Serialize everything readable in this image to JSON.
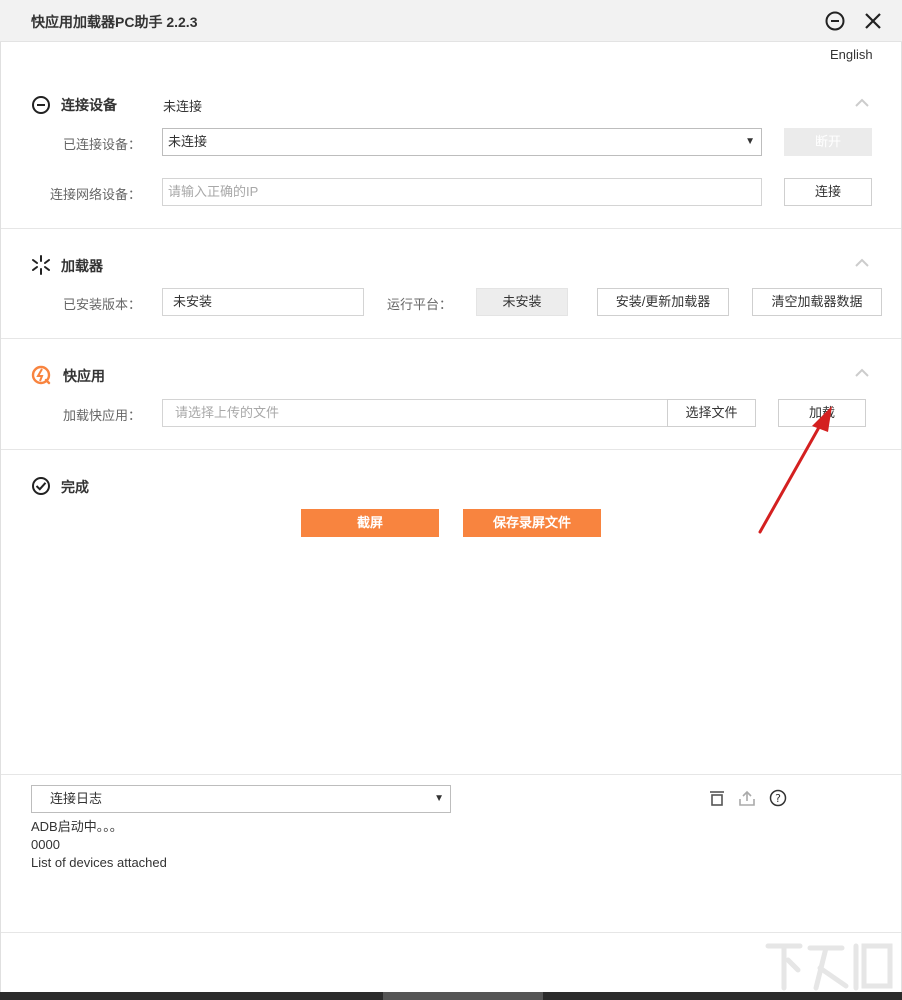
{
  "window": {
    "title": "快应用加载器PC助手 2.2.3",
    "language": "English"
  },
  "connect": {
    "title": "连接设备",
    "status": "未连接",
    "device_label": "已连接设备：",
    "device_value": "未连接",
    "disconnect_label": "断开",
    "network_label": "连接网络设备：",
    "ip_placeholder": "请输入正确的IP",
    "connect_label": "连接"
  },
  "loader": {
    "title": "加载器",
    "version_label": "已安装版本：",
    "version_value": "未安装",
    "platform_label": "运行平台：",
    "platform_value": "未安装",
    "install_label": "安装/更新加载器",
    "clear_label": "清空加载器数据"
  },
  "quickapp": {
    "title": "快应用",
    "load_label": "加载快应用：",
    "file_placeholder": "请选择上传的文件",
    "choose_label": "选择文件",
    "load_button": "加载"
  },
  "done": {
    "title": "完成",
    "screenshot_label": "截屏",
    "save_record_label": "保存录屏文件"
  },
  "log": {
    "selected": "连接日志",
    "lines": [
      "ADB启动中。。。",
      "0000",
      "List of devices attached"
    ]
  },
  "colors": {
    "accent": "#f8843f",
    "annotation_arrow": "#d42020",
    "titlebar": "#f2f2f2"
  },
  "icons": {
    "minimize": "minimize-circle-icon",
    "close": "close-icon",
    "connect": "connect-icon",
    "loader": "loader-spark-icon",
    "quickapp": "quickapp-icon",
    "done": "check-circle-icon",
    "clear_log": "trash-icon",
    "export_log": "upload-icon",
    "help": "help-icon"
  }
}
